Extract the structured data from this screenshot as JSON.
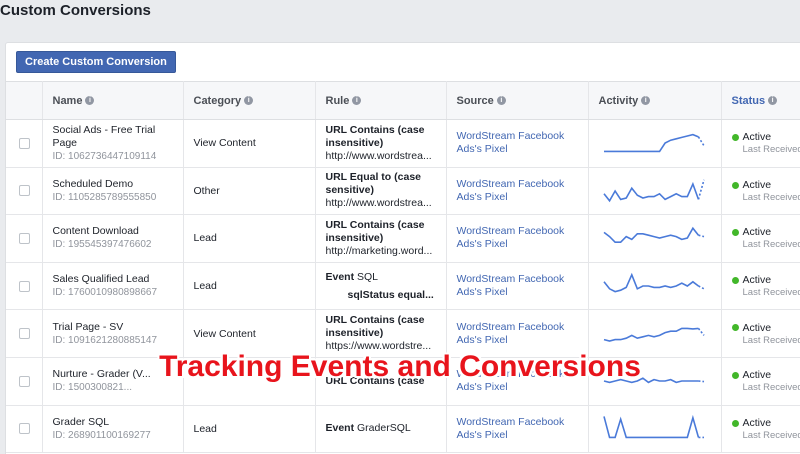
{
  "page_title": "Custom Conversions",
  "create_button": "Create Custom Conversion",
  "columns": {
    "name": "Name",
    "category": "Category",
    "rule": "Rule",
    "source": "Source",
    "activity": "Activity",
    "status": "Status"
  },
  "colors": {
    "accent": "#4267b2",
    "sparkline": "#4a7ad9",
    "active_dot": "#42b72a",
    "overlay": "#e8141c"
  },
  "rows": [
    {
      "name": "Social Ads - Free Trial Page",
      "id": "ID: 1062736447109114",
      "category": "View Content",
      "rule_bold": "URL Contains (case insensitive)",
      "rule_detail": "http://www.wordstrea...",
      "source": "WordStream Facebook Ads's Pixel",
      "status": "Active",
      "last": "Last Received"
    },
    {
      "name": "Scheduled Demo",
      "id": "ID: 1105285789555850",
      "category": "Other",
      "rule_bold": "URL Equal to (case sensitive)",
      "rule_detail": "http://www.wordstrea...",
      "source": "WordStream Facebook Ads's Pixel",
      "status": "Active",
      "last": "Last Received"
    },
    {
      "name": "Content Download",
      "id": "ID: 195545397476602",
      "category": "Lead",
      "rule_bold": "URL Contains (case insensitive)",
      "rule_detail": "http://marketing.word...",
      "source": "WordStream Facebook Ads's Pixel",
      "status": "Active",
      "last": "Last Received"
    },
    {
      "name": "Sales Qualified Lead",
      "id": "ID: 1760010980898667",
      "category": "Lead",
      "rule_label": "Event",
      "rule_value": "SQL",
      "rule_indent": "sqlStatus equal...",
      "source": "WordStream Facebook Ads's Pixel",
      "status": "Active",
      "last": "Last Received"
    },
    {
      "name": "Trial Page - SV",
      "id": "ID: 1091621280885147",
      "category": "View Content",
      "rule_bold": "URL Contains (case insensitive)",
      "rule_detail": "https://www.wordstre...",
      "source": "WordStream Facebook Ads's Pixel",
      "status": "Active",
      "last": "Last Received"
    },
    {
      "name": "Nurture - Grader (V...",
      "id": "ID: 1500300821...",
      "category": "",
      "rule_bold": "URL Contains (case",
      "rule_detail": "",
      "source": "WordStream Facebook Ads's Pixel",
      "status": "Active",
      "last": "Last Received"
    },
    {
      "name": "Grader SQL",
      "id": "ID: 268901100169277",
      "category": "Lead",
      "rule_label": "Event",
      "rule_value": "GraderSQL",
      "source": "WordStream Facebook Ads's Pixel",
      "status": "Active",
      "last": "Last Received"
    }
  ],
  "activity": [
    [
      0.2,
      0.2,
      0.2,
      0.2,
      0.2,
      0.2,
      0.2,
      0.2,
      0.2,
      0.2,
      0.2,
      0.5,
      0.6,
      0.65,
      0.7,
      0.75,
      0.8,
      0.72,
      0.4
    ],
    [
      0.4,
      0.15,
      0.5,
      0.2,
      0.25,
      0.6,
      0.35,
      0.25,
      0.3,
      0.3,
      0.4,
      0.2,
      0.3,
      0.4,
      0.3,
      0.3,
      0.75,
      0.2,
      0.9
    ],
    [
      0.7,
      0.55,
      0.35,
      0.35,
      0.55,
      0.45,
      0.65,
      0.65,
      0.6,
      0.55,
      0.5,
      0.55,
      0.6,
      0.55,
      0.45,
      0.5,
      0.85,
      0.6,
      0.55
    ],
    [
      0.65,
      0.4,
      0.3,
      0.35,
      0.45,
      0.9,
      0.4,
      0.5,
      0.5,
      0.45,
      0.45,
      0.5,
      0.45,
      0.5,
      0.6,
      0.5,
      0.65,
      0.5,
      0.4
    ],
    [
      0.3,
      0.25,
      0.3,
      0.3,
      0.35,
      0.45,
      0.35,
      0.4,
      0.45,
      0.4,
      0.45,
      0.55,
      0.6,
      0.6,
      0.7,
      0.7,
      0.68,
      0.7,
      0.45
    ],
    [
      0.5,
      0.45,
      0.5,
      0.55,
      0.5,
      0.45,
      0.5,
      0.6,
      0.45,
      0.55,
      0.5,
      0.5,
      0.55,
      0.45,
      0.5,
      0.5,
      0.5,
      0.5,
      0.48
    ],
    [
      0.95,
      0.2,
      0.2,
      0.85,
      0.2,
      0.2,
      0.2,
      0.2,
      0.2,
      0.2,
      0.2,
      0.2,
      0.2,
      0.2,
      0.2,
      0.2,
      0.9,
      0.2,
      0.2
    ]
  ],
  "overlay_text": "Tracking Events and Conversions"
}
